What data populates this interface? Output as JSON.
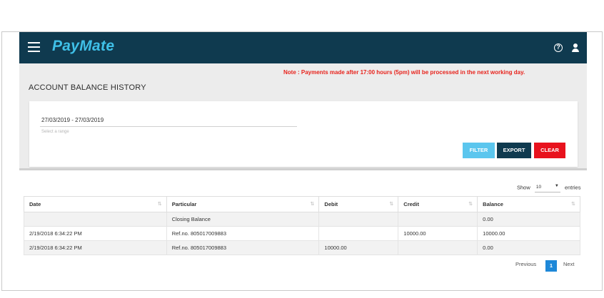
{
  "header": {
    "brand": "PayMate",
    "help_glyph": "?",
    "icons": [
      "menu-icon",
      "help-icon",
      "user-icon"
    ],
    "color": "#0f3a4f",
    "brand_color": "#3fc0e8"
  },
  "notice": "Note : Payments made after 17:00 hours (5pm) will be processed in the next working day.",
  "page_title": "ACCOUNT BALANCE HISTORY",
  "filter": {
    "date_range_value": "27/03/2019 - 27/03/2019",
    "date_range_placeholder": "Select a range",
    "filter_label": "FILTER",
    "export_label": "EXPORT",
    "clear_label": "CLEAR"
  },
  "table": {
    "show_label": "Show",
    "page_size": "10",
    "entries_label": "entries",
    "columns": [
      "Date",
      "Particular",
      "Debit",
      "Credit",
      "Balance"
    ],
    "rows": [
      [
        "",
        "Closing Balance",
        "",
        "",
        "0.00"
      ],
      [
        "2/19/2018 6:34:22 PM",
        "Ref.no. 805017009883",
        "",
        "10000.00",
        "10000.00"
      ],
      [
        "2/19/2018 6:34:22 PM",
        "Ref.no. 805017009883",
        "10000.00",
        "",
        "0.00"
      ]
    ]
  },
  "pagination": {
    "previous": "Previous",
    "current_page": "1",
    "next": "Next"
  }
}
